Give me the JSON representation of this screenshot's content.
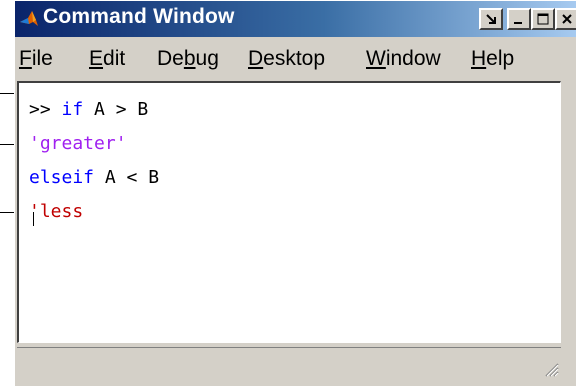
{
  "window": {
    "title": "Command Window"
  },
  "menu": [
    {
      "label": "File",
      "accel": "F",
      "rest": "ile"
    },
    {
      "label": "Edit",
      "accel": "E",
      "rest": "dit"
    },
    {
      "label": "Debug",
      "pre": "De",
      "accel": "b",
      "rest": "ug"
    },
    {
      "label": "Desktop",
      "accel": "D",
      "rest": "esktop"
    },
    {
      "label": "Window",
      "accel": "W",
      "rest": "indow"
    },
    {
      "label": "Help",
      "accel": "H",
      "rest": "elp"
    }
  ],
  "code": {
    "line1_prompt": ">> ",
    "line1_kw": "if",
    "line1_rest": " A > B",
    "line2_str": "'greater'",
    "line3_kw": "elseif",
    "line3_rest": " A < B",
    "line4_str": "'less"
  },
  "colors": {
    "keyword": "#0000ff",
    "string": "#a020f0",
    "unterminated_string": "#c00000"
  }
}
